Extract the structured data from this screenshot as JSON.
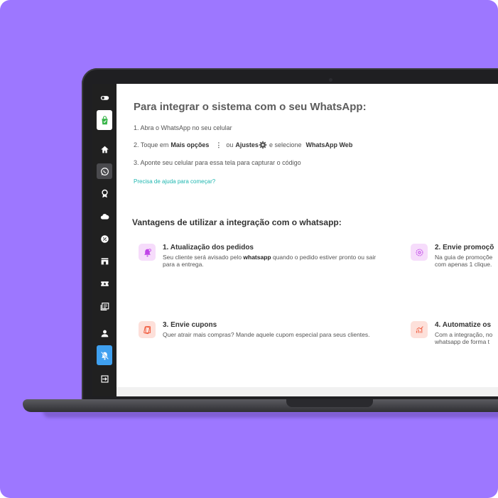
{
  "integration": {
    "heading": "Para integrar o sistema com o seu WhatsApp:",
    "step1": "1. Abra o WhatsApp no seu celular",
    "step2_prefix": "2. Toque em",
    "step2_more": "Mais opções",
    "step2_dots": "⋮",
    "step2_or": "ou",
    "step2_settings": "Ajustes",
    "step2_select": "e selecione",
    "step2_web": "WhatsApp Web",
    "step3": "3. Aponte seu celular para essa tela para capturar o código",
    "help_link": "Precisa de ajuda para começar?"
  },
  "advantages": {
    "heading": "Vantagens de utilizar a integração com o whatsapp:",
    "items": [
      {
        "title": "1. Atualização dos pedidos",
        "desc_before": "Seu cliente será avisado pelo ",
        "desc_bold": "whatsapp",
        "desc_after": " quando o pedido estiver pronto ou sair para a entrega.",
        "icon": "bell-icon",
        "color": "#c044e8"
      },
      {
        "title": "2. Envie promoçõ",
        "desc": "Na guia de promoçõe com apenas 1 clique.",
        "icon": "gear-badge-icon",
        "color": "#c044e8"
      },
      {
        "title": "3. Envie cupons",
        "desc": "Quer atrair mais compras? Mande aquele cupom especial para seus clientes.",
        "icon": "coupon-icon",
        "color": "#f05a3c"
      },
      {
        "title": "4. Automatize os",
        "desc": "Com a integração, no whatsapp de forma t",
        "icon": "chart-icon",
        "color": "#f05a3c"
      }
    ]
  },
  "colors": {
    "background": "#9d77ff",
    "sidebar": "#202020",
    "link": "#1fb7b0",
    "active_bell": "#3fa0f0"
  },
  "sidebar_icons": [
    "toggle-icon",
    "store-icon",
    "home-icon",
    "whatsapp-icon",
    "award-icon",
    "cloud-icon",
    "badge-percent-icon",
    "storefront-icon",
    "ticket-icon",
    "news-icon",
    "user-icon",
    "bell-off-icon",
    "logout-icon"
  ]
}
